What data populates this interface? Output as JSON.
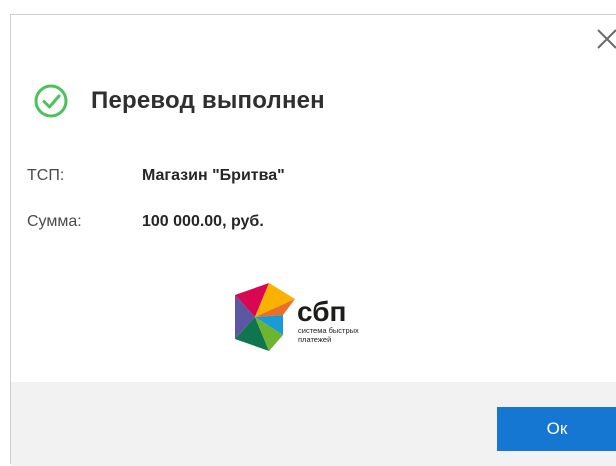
{
  "dialog": {
    "title": "Перевод выполнен",
    "close_icon": "close-icon",
    "status_icon": "success-check-icon",
    "success_color": "#4cc35a",
    "fields": [
      {
        "label": "ТСП:",
        "value": "Магазин \"Бритва\""
      },
      {
        "label": "Сумма:",
        "value": "100 000.00, руб."
      }
    ],
    "logo": {
      "name": "сбп",
      "tagline_line1": "система быстрых",
      "tagline_line2": "платежей"
    },
    "ok_label": "Ок",
    "accent_color": "#1677d2"
  }
}
